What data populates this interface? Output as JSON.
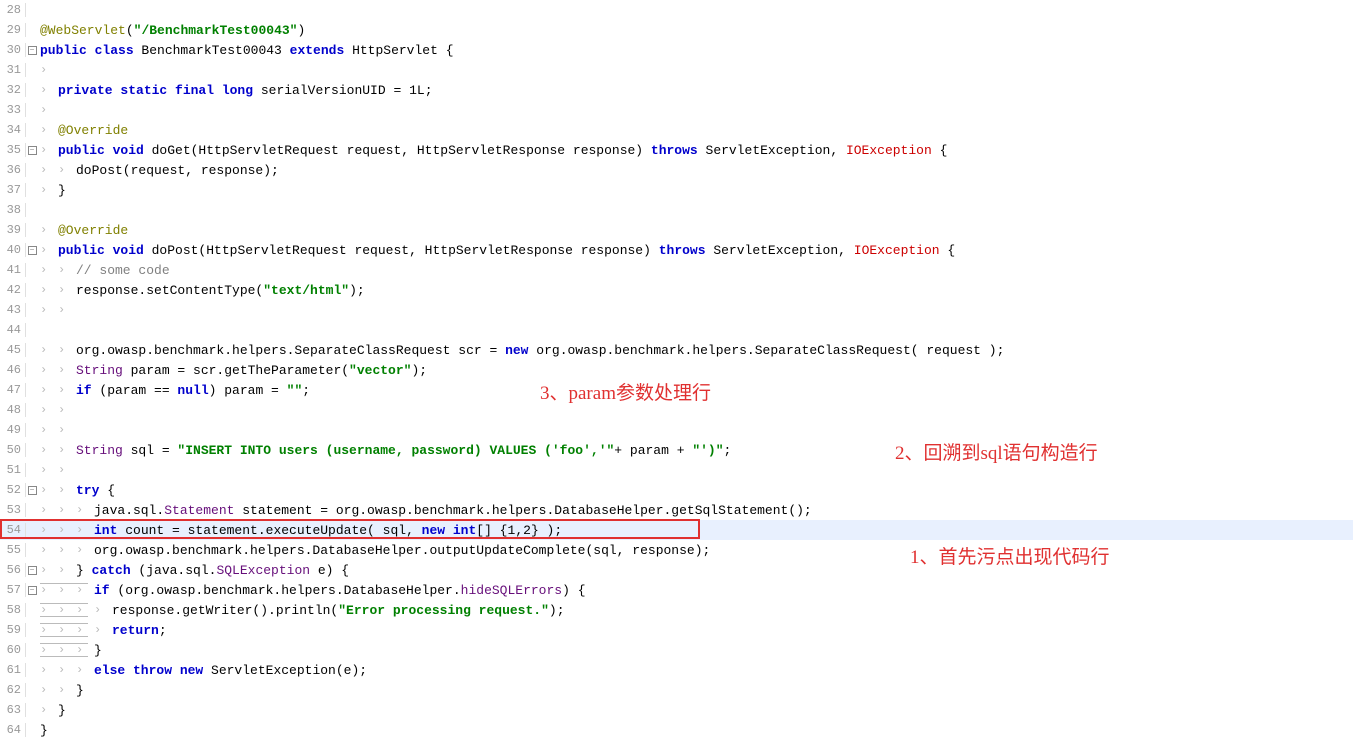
{
  "annotations": {
    "a1": "1、首先污点出现代码行",
    "a2": "2、回溯到sql语句构造行",
    "a3": "3、param参数处理行"
  },
  "code": {
    "l29_ann": "@WebServlet",
    "l29_paren_open": "(",
    "l29_str": "\"/BenchmarkTest00043\"",
    "l29_paren_close": ")",
    "l30_kw": "public class ",
    "l30_cls": "BenchmarkTest00043 ",
    "l30_kw2": "extends ",
    "l30_txt": "HttpServlet {",
    "l32_kw": "private static final long ",
    "l32_txt": "serialVersionUID = ",
    "l32_num": "1L",
    "l32_end": ";",
    "l34_ann": "@Override",
    "l35_kw": "public void ",
    "l35_txt": "doGet(HttpServletRequest request, HttpServletResponse response) ",
    "l35_kw2": "throws ",
    "l35_txt2": "ServletException, ",
    "l35_exc": "IOException ",
    "l35_brace": "{",
    "l36_txt": "doPost(request, response);",
    "l37_txt": "}",
    "l39_ann": "@Override",
    "l40_kw": "public void ",
    "l40_txt": "doPost(HttpServletRequest request, HttpServletResponse response) ",
    "l40_kw2": "throws ",
    "l40_txt2": "ServletException, ",
    "l40_exc": "IOException ",
    "l40_brace": "{",
    "l41_cmt": "// some code",
    "l42_txt": "response.setContentType(",
    "l42_str": "\"text/html\"",
    "l42_end": ");",
    "l45_txt": "org.owasp.benchmark.helpers.SeparateClassRequest scr = ",
    "l45_kw": "new ",
    "l45_txt2": "org.owasp.benchmark.helpers.SeparateClassRequest( request );",
    "l46_cls": "String ",
    "l46_txt": "param = scr.getTheParameter(",
    "l46_str": "\"vector\"",
    "l46_end": ");",
    "l47_kw": "if ",
    "l47_txt": "(param == ",
    "l47_kw2": "null",
    "l47_txt2": ") param = ",
    "l47_str": "\"\"",
    "l47_end": ";",
    "l50_cls": "String ",
    "l50_txt": "sql = ",
    "l50_str": "\"INSERT INTO users (username, password) VALUES ('foo','\"",
    "l50_txt2": "+ param + ",
    "l50_str2": "\"')\"",
    "l50_end": ";",
    "l52_kw": "try ",
    "l52_brace": "{",
    "l53_txt": "java.sql.",
    "l53_cls": "Statement ",
    "l53_txt2": "statement = org.owasp.benchmark.helpers.DatabaseHelper.getSqlStatement();",
    "l54_kw": "int ",
    "l54_txt": "count = statement.executeUpdate( sql, ",
    "l54_kw2": "new int",
    "l54_txt2": "[] {",
    "l54_num": "1",
    "l54_comma": ",",
    "l54_num2": "2",
    "l54_end": "} );",
    "l55_txt": "org.owasp.benchmark.helpers.DatabaseHelper.outputUpdateComplete(sql, response);",
    "l56_txt": "} ",
    "l56_kw": "catch ",
    "l56_txt2": "(java.sql.",
    "l56_cls": "SQLException ",
    "l56_txt3": "e) {",
    "l57_kw": "if ",
    "l57_txt": "(org.owasp.benchmark.helpers.DatabaseHelper.",
    "l57_fld": "hideSQLErrors",
    "l57_end": ") {",
    "l58_txt": "response.getWriter().println(",
    "l58_str": "\"Error processing request.\"",
    "l58_end": ");",
    "l59_kw": "return",
    "l59_end": ";",
    "l60_txt": "}",
    "l61_kw": "else throw new ",
    "l61_txt": "ServletException(e);",
    "l62_txt": "}",
    "l63_txt": "}",
    "l64_txt": "}"
  },
  "lines": [
    28,
    29,
    30,
    31,
    32,
    33,
    34,
    35,
    36,
    37,
    38,
    39,
    40,
    41,
    42,
    43,
    44,
    45,
    46,
    47,
    48,
    49,
    50,
    51,
    52,
    53,
    54,
    55,
    56,
    57,
    58,
    59,
    60,
    61,
    62,
    63,
    64
  ]
}
